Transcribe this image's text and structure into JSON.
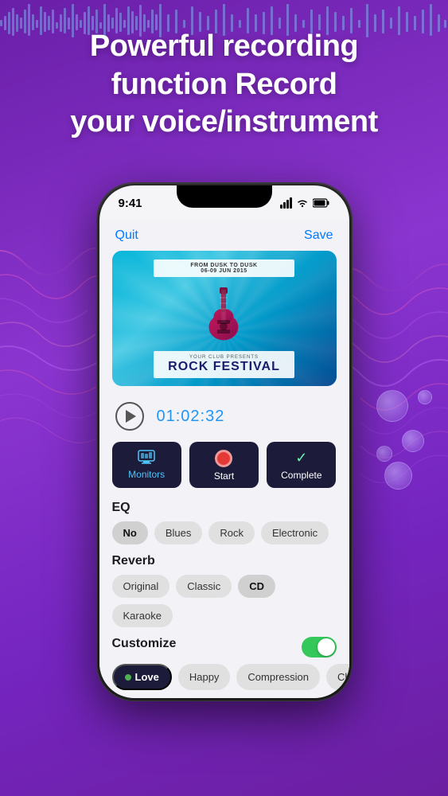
{
  "background": {
    "color": "#7B2FBE"
  },
  "header": {
    "title_line1": "Powerful recording",
    "title_line2": "function Record",
    "title_line3": "your voice/instrument"
  },
  "phone": {
    "status_bar": {
      "time": "9:41",
      "signal": "●●●",
      "wifi": "wifi",
      "battery": "battery"
    },
    "nav": {
      "quit_label": "Quit",
      "save_label": "Save"
    },
    "album": {
      "top_banner_line1": "FROM DUSK TO DUSK",
      "top_banner_line2": "06-09 JUN 2015",
      "your_club": "YOUR CLUB PRESENTS",
      "festival_name": "ROCK FESTIVAL"
    },
    "playback": {
      "time": "01:02:32"
    },
    "action_buttons": [
      {
        "id": "monitors",
        "label": "Monitors",
        "icon": "monitor-icon"
      },
      {
        "id": "start",
        "label": "Start",
        "icon": "record-icon"
      },
      {
        "id": "complete",
        "label": "Complete",
        "icon": "check-icon"
      }
    ],
    "eq": {
      "label": "EQ",
      "options": [
        "No",
        "Blues",
        "Rock",
        "Electronic"
      ],
      "selected": "No"
    },
    "reverb": {
      "label": "Reverb",
      "options": [
        "Original",
        "Classic",
        "CD",
        "Karaoke"
      ],
      "selected": "CD"
    },
    "customize": {
      "label": "Customize",
      "toggle_on": true,
      "options": [
        "Love",
        "Happy",
        "Compression",
        "Chorus"
      ],
      "selected": "Love"
    }
  }
}
